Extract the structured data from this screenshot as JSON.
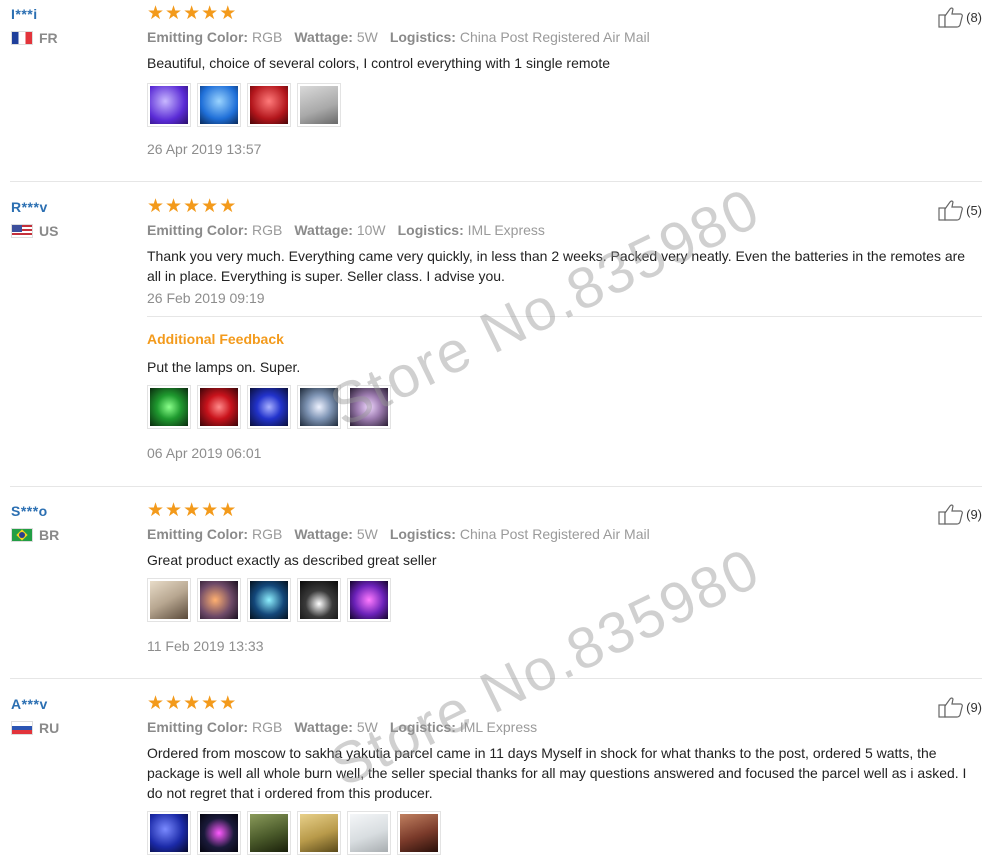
{
  "reviews": [
    {
      "user": "I***i",
      "country": "FR",
      "flag": "fr",
      "likes": "(8)",
      "emitting_label": "Emitting Color:",
      "emitting_value": "RGB",
      "wattage_label": "Wattage:",
      "wattage_value": "5W",
      "logistics_label": "Logistics:",
      "logistics_value": "China Post Registered Air Mail",
      "text": "Beautiful, choice of several colors, I control everything with 1 single remote",
      "date": "26 Apr 2019 13:57",
      "thumbs": [
        "#5a2bd6",
        "#1f6fd8",
        "#b3161c",
        "#a9a9a9"
      ]
    },
    {
      "user": "R***v",
      "country": "US",
      "flag": "us",
      "likes": "(5)",
      "emitting_label": "Emitting Color:",
      "emitting_value": "RGB",
      "wattage_label": "Wattage:",
      "wattage_value": "10W",
      "logistics_label": "Logistics:",
      "logistics_value": "IML Express",
      "text": "Thank you very much. Everything came very quickly, in less than 2 weeks. Packed very neatly. Even the batteries in the remotes are all in place. Everything is super. Seller class. I advise you.",
      "date": "26 Feb 2019 09:19",
      "additional": {
        "title": "Additional Feedback",
        "text": "Put the lamps on. Super.",
        "date": "06 Apr 2019 06:01",
        "thumbs": [
          "#1f9a2f",
          "#c9131c",
          "#2233cc",
          "#7f95b5",
          "#9d7cb0"
        ]
      }
    },
    {
      "user": "S***o",
      "country": "BR",
      "flag": "br",
      "likes": "(9)",
      "emitting_label": "Emitting Color:",
      "emitting_value": "RGB",
      "wattage_label": "Wattage:",
      "wattage_value": "5W",
      "logistics_label": "Logistics:",
      "logistics_value": "China Post Registered Air Mail",
      "text": "Great product exactly as described great seller",
      "date": "11 Feb 2019 13:33",
      "thumbs": [
        "#b7a690",
        "#6e4a68",
        "#13477a",
        "#3a3a3a",
        "#6a21b8"
      ]
    },
    {
      "user": "A***v",
      "country": "RU",
      "flag": "ru",
      "likes": "(9)",
      "emitting_label": "Emitting Color:",
      "emitting_value": "RGB",
      "wattage_label": "Wattage:",
      "wattage_value": "5W",
      "logistics_label": "Logistics:",
      "logistics_value": "IML Express",
      "text": "Ordered from moscow to sakha yakutia parcel came in 11 days Myself in shock for what thanks to the post, ordered 5 watts, the package is well all whole burn well, the seller special thanks for all may questions answered and focused the parcel well as i asked. I do not regret that i ordered from this producer.",
      "thumbs": [
        "#1b2aa8",
        "#1a1a3a",
        "#4a5a2a",
        "#b89a4a",
        "#d8dde0",
        "#7a3a2a"
      ]
    }
  ],
  "watermark_text": "Store No.835980",
  "colors": {
    "star": "#f39a1b",
    "username": "#2b6fb2",
    "additional_title": "#f39a1b"
  }
}
